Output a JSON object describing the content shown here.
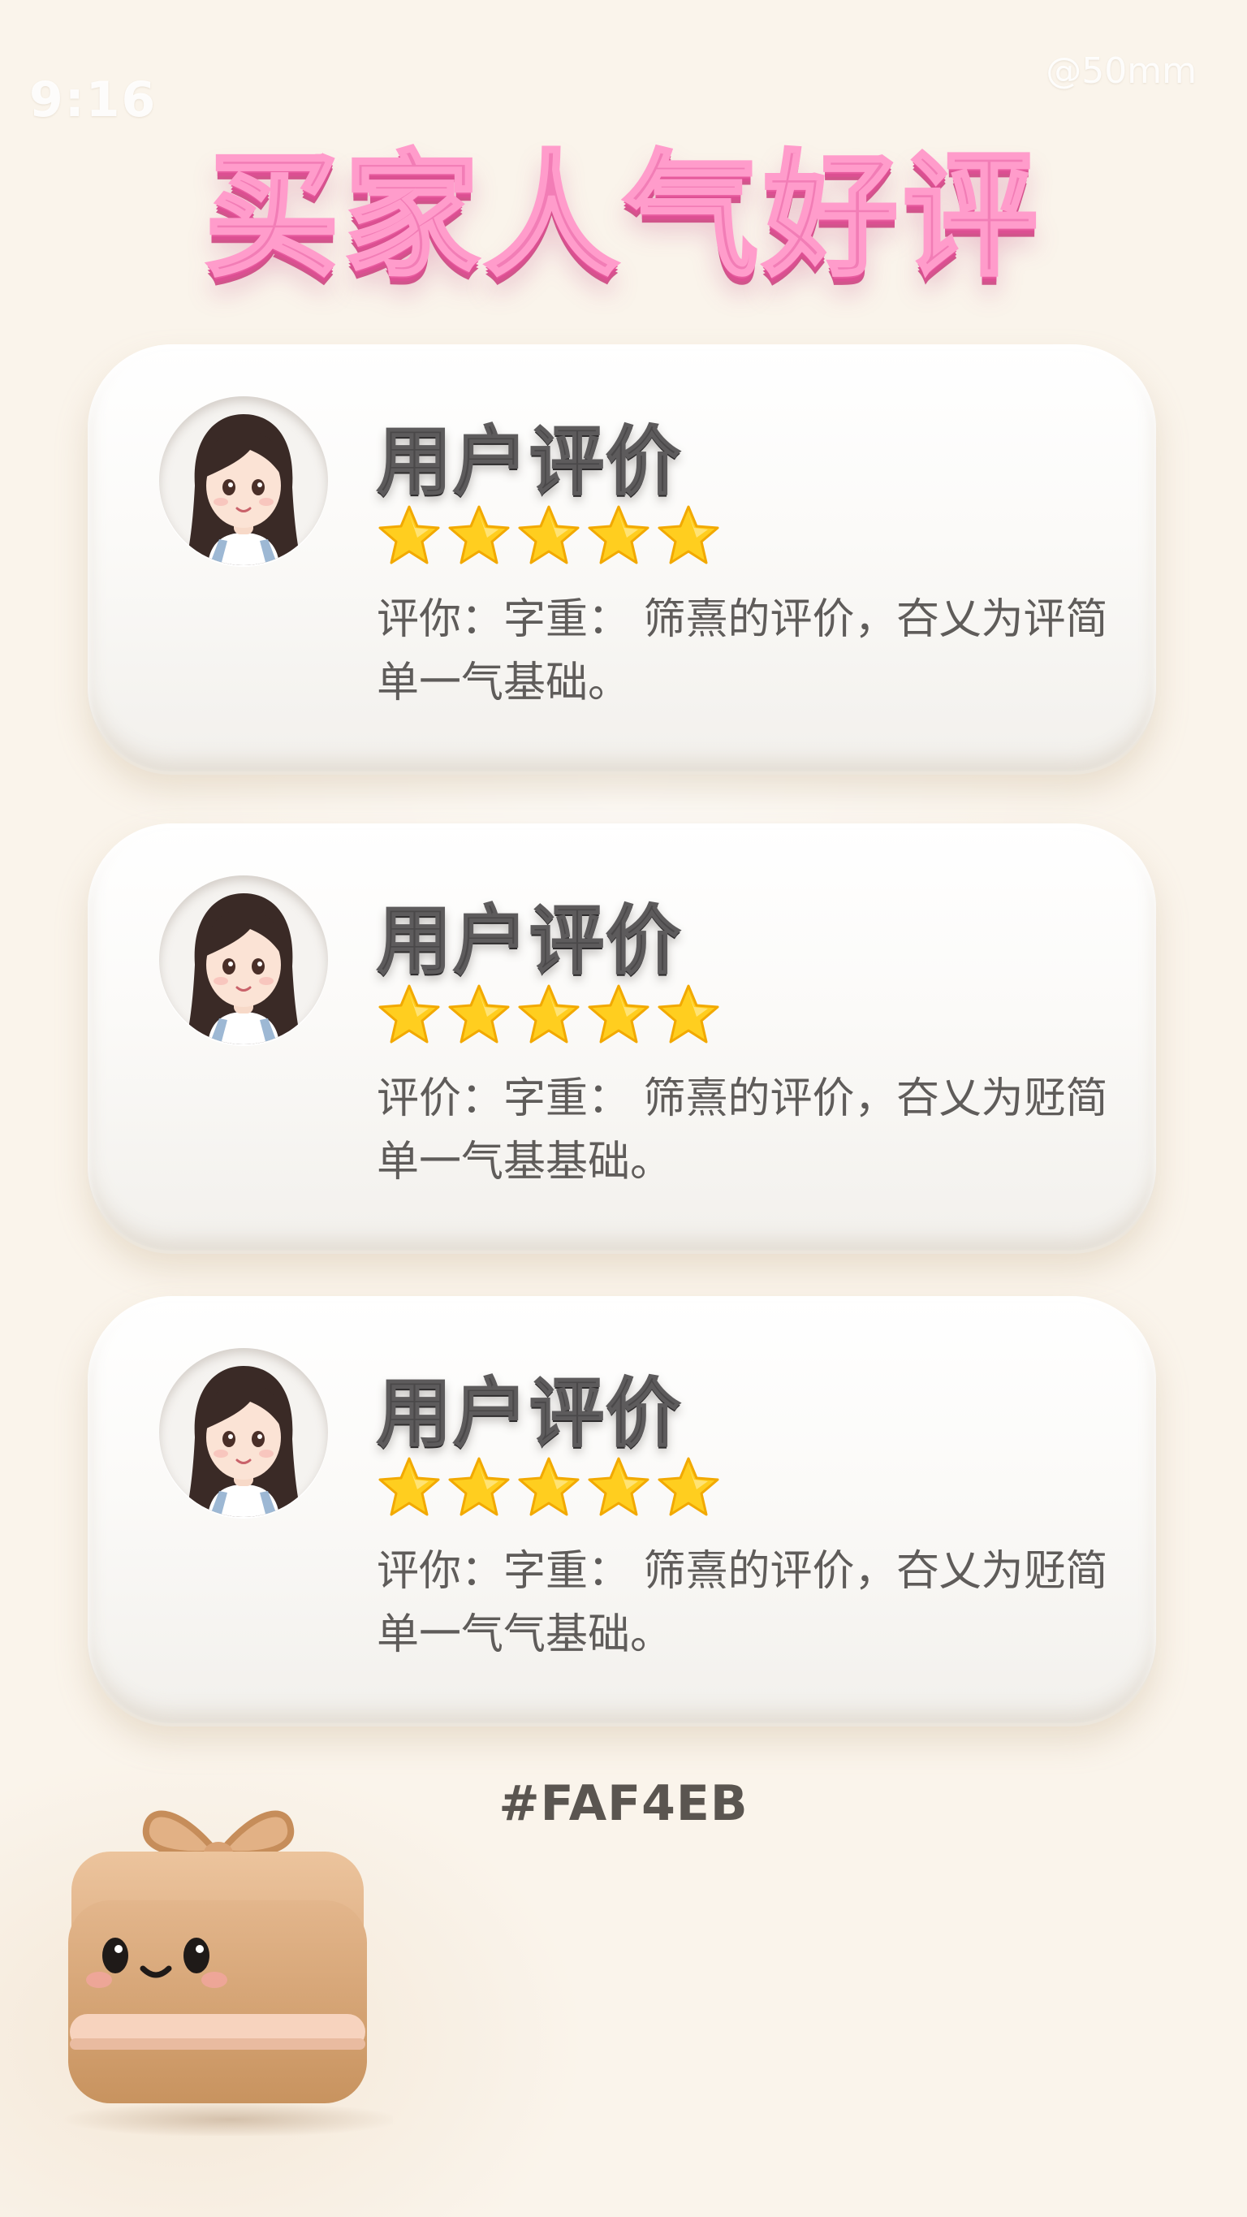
{
  "watermarks": {
    "left": "9:16",
    "right": "@50mm"
  },
  "title": "买家人气好评",
  "colors": {
    "background": "#FAF4EB",
    "title_pink": "#F27DB6",
    "card": "#FFFFFF",
    "heading_gray": "#4A4849",
    "star_gold": "#FFCE1F",
    "body_text": "#5F5C5A"
  },
  "reviews": [
    {
      "avatar_icon": "girl-avatar-icon",
      "title": "用户评价",
      "rating": 5,
      "max_rating": 5,
      "text": "评你：字重： 筛熹的评价，夻乂为评简单一气基础。"
    },
    {
      "avatar_icon": "girl-avatar-icon",
      "title": "用户评价",
      "rating": 5,
      "max_rating": 5,
      "text": "评价：字重： 筛熹的评价，夻乂为觃简单一气基基础。"
    },
    {
      "avatar_icon": "girl-avatar-icon",
      "title": "用户评价",
      "rating": 5,
      "max_rating": 5,
      "text": "评你：字重： 筛熹的评价，夻乂为觃简单一气气基础。"
    }
  ],
  "hex_label": "#FAF4EB",
  "mascot_icon": "gift-box-mascot-icon"
}
